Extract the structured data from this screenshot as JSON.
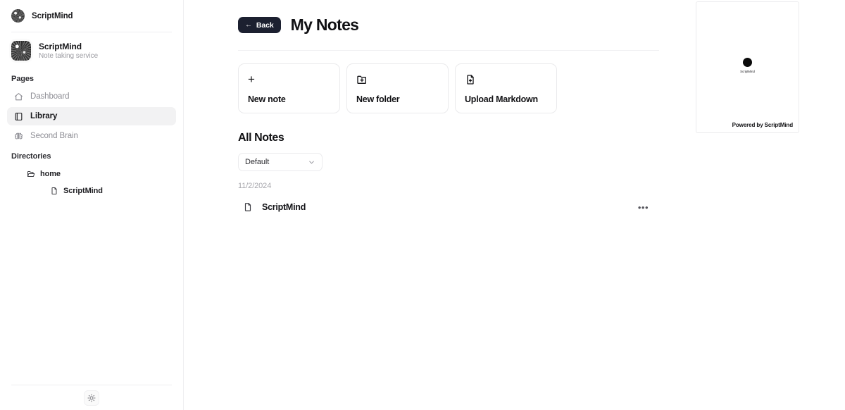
{
  "sidebar": {
    "brandbar": {
      "name": "ScriptMind",
      "avatar_icon": "scriptmind-logo-icon"
    },
    "workspace": {
      "title": "ScriptMind",
      "subtitle": "Note taking service",
      "avatar_icon": "scriptmind-logo-icon"
    },
    "pages_label": "Pages",
    "nav_items": [
      {
        "label": "Dashboard",
        "icon": "home-icon",
        "active": false
      },
      {
        "label": "Library",
        "icon": "book-icon",
        "active": true
      },
      {
        "label": "Second Brain",
        "icon": "brain-icon",
        "active": false
      }
    ],
    "directories_label": "Directories",
    "tree": [
      {
        "label": "home",
        "icon": "folder-open-icon",
        "level": 1
      },
      {
        "label": "ScriptMind",
        "icon": "file-icon",
        "level": 2
      }
    ],
    "theme_toggle_icon": "sun-icon"
  },
  "main": {
    "back_button": {
      "label": "Back",
      "icon": "arrow-left-icon"
    },
    "title": "My Notes",
    "action_cards": [
      {
        "label": "New note",
        "icon": "plus-icon"
      },
      {
        "label": "New folder",
        "icon": "folder-plus-icon"
      },
      {
        "label": "Upload Markdown",
        "icon": "file-upload-icon"
      }
    ],
    "section_title": "All Notes",
    "sort_select": {
      "value": "Default",
      "icon": "chevron-down-icon",
      "options": [
        "Default"
      ]
    },
    "date_group": "11/2/2024",
    "notes": [
      {
        "name": "ScriptMind",
        "icon": "file-icon",
        "menu_icon": "more-horizontal-icon",
        "menu_label": "•••"
      }
    ]
  },
  "preview_card": {
    "dot_label": "ScriptMind",
    "footer": "Powered by ScriptMind"
  },
  "colors": {
    "accent_dark": "#1c2030",
    "text_primary": "#111114",
    "text_muted": "#9b9ba1",
    "border": "#ebebed",
    "active_bg": "#f2f2f3"
  }
}
